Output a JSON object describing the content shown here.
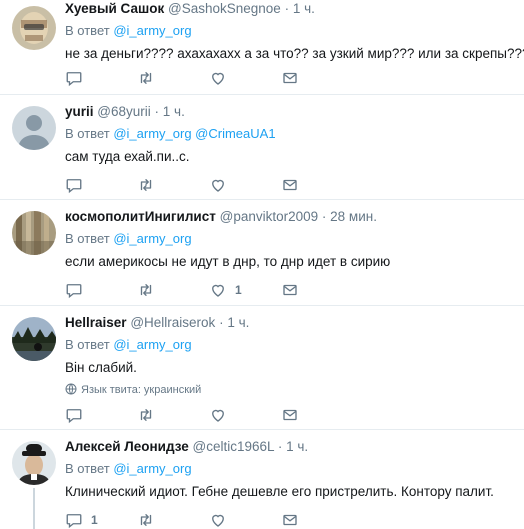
{
  "tweets": [
    {
      "name": "Хуевый Сашок",
      "handle": "@SashokSnegnoe",
      "dot": "·",
      "time": "1 ч.",
      "reply_prefix": "В ответ",
      "reply_mentions": "@i_army_org",
      "text": "не за деньги???? ахахахахх а за что?? за узкий мир??? или за скрепы????",
      "reply_count": "",
      "like_count": ""
    },
    {
      "name": "yurii",
      "handle": "@68yurii",
      "dot": "·",
      "time": "1 ч.",
      "reply_prefix": "В ответ",
      "reply_mentions": "@i_army_org @CrimeaUA1",
      "text": "сам туда ехай.пи..с.",
      "reply_count": "",
      "like_count": ""
    },
    {
      "name": "космополитИнигилист",
      "handle": "@panviktor2009",
      "dot": "·",
      "time": "28 мин.",
      "reply_prefix": "В ответ",
      "reply_mentions": "@i_army_org",
      "text": "если америкосы не идут в днр, то днр идет в сирию",
      "reply_count": "",
      "like_count": "1"
    },
    {
      "name": "Hellraiser",
      "handle": "@Hellraiserok",
      "dot": "·",
      "time": "1 ч.",
      "reply_prefix": "В ответ",
      "reply_mentions": "@i_army_org",
      "text": "Він слабий.",
      "language_note": "Язык твита: украинский",
      "reply_count": "",
      "like_count": ""
    },
    {
      "name": "Алексей Леонидзе",
      "handle": "@celtic1966L",
      "dot": "·",
      "time": "1 ч.",
      "reply_prefix": "В ответ",
      "reply_mentions": "@i_army_org",
      "text": "Клинический идиот. Гебне дешевле его пристрелить. Контору палит.",
      "reply_count": "1",
      "like_count": ""
    }
  ],
  "colors": {
    "accent": "#1da1f2",
    "muted": "#657786",
    "border": "#e6ecf0"
  },
  "icons": {
    "reply": "reply-icon",
    "retweet": "retweet-icon",
    "like": "heart-icon",
    "message": "envelope-icon",
    "language": "globe-icon"
  }
}
